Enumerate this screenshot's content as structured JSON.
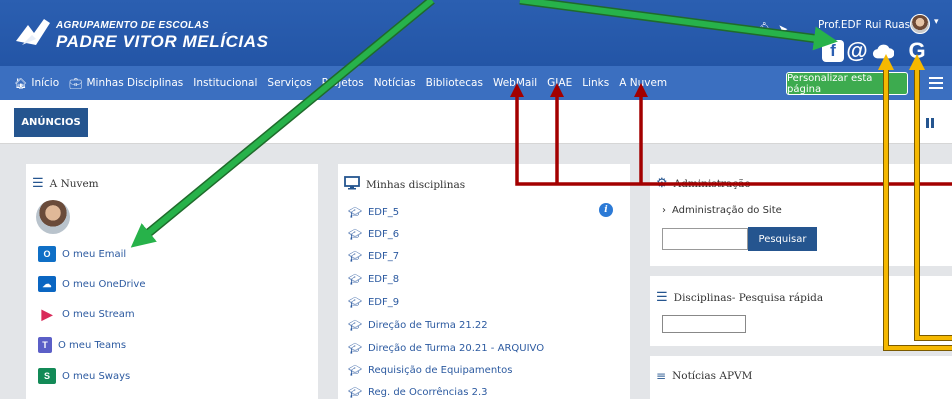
{
  "header": {
    "school_line1": "AGRUPAMENTO DE ESCOLAS",
    "school_line2": "PADRE VITOR MELÍCIAS",
    "user_name": "Prof.EDF Rui Ruas",
    "icons": [
      "bell-icon",
      "message-icon",
      "facebook-icon",
      "at-icon",
      "cloud-icon",
      "google-icon"
    ]
  },
  "nav": {
    "items": [
      "Início",
      "Minhas Disciplinas",
      "Institucional",
      "Serviços",
      "Projetos",
      "Notícias",
      "Bibliotecas",
      "WebMail",
      "GIAE",
      "Links",
      "A Nuvem"
    ],
    "personalize": "Personalizar esta página"
  },
  "announcements": {
    "tab": "ANÚNCIOS"
  },
  "nuvem_block": {
    "title": "A Nuvem",
    "items": [
      {
        "label": "O meu Email",
        "icon": "outlook-icon",
        "color": "#0f6fc6",
        "glyph": "O"
      },
      {
        "label": "O meu OneDrive",
        "icon": "onedrive-icon",
        "color": "#0a66c2",
        "glyph": "☁"
      },
      {
        "label": "O meu Stream",
        "icon": "stream-icon",
        "color": "#d92b5a",
        "glyph": "▶"
      },
      {
        "label": "O meu Teams",
        "icon": "teams-icon",
        "color": "#5b5fc7",
        "glyph": "T"
      },
      {
        "label": "O meu Sways",
        "icon": "sway-icon",
        "color": "#138a57",
        "glyph": "S"
      }
    ]
  },
  "disciplinas_block": {
    "title": "Minhas disciplinas",
    "items": [
      "EDF_5",
      "EDF_6",
      "EDF_7",
      "EDF_8",
      "EDF_9",
      "Direção de Turma 21.22",
      "Direção de Turma 20.21 - ARQUIVO",
      "Requisição de Equipamentos",
      "Reg. de Ocorrências 2.3"
    ]
  },
  "admin_block": {
    "title": "Administração",
    "site_admin": "Administração do Site",
    "search_button": "Pesquisar"
  },
  "quick_block": {
    "title": "Disciplinas- Pesquisa rápida"
  },
  "news_block": {
    "title": "Notícias APVM"
  },
  "colors": {
    "header": "#2b5fb1",
    "nav": "#3b6fc0",
    "accent_green": "#3dab4f",
    "arrow_green": "#27b24a",
    "arrow_red": "#a30000",
    "arrow_yellow": "#f5b800"
  }
}
